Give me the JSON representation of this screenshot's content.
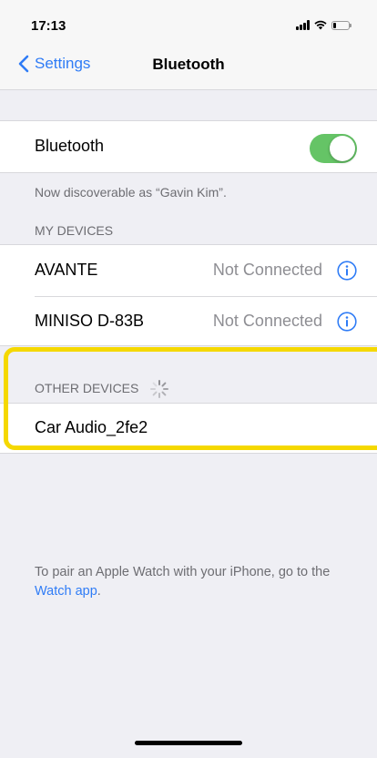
{
  "status_bar": {
    "time": "17:13",
    "battery_level": 0.2
  },
  "nav": {
    "back_label": "Settings",
    "title": "Bluetooth"
  },
  "bluetooth": {
    "label": "Bluetooth",
    "enabled": true,
    "discoverable_text": "Now discoverable as “Gavin Kim”."
  },
  "my_devices": {
    "header": "MY DEVICES",
    "items": [
      {
        "name": "AVANTE",
        "status": "Not Connected"
      },
      {
        "name": "MINISO D-83B",
        "status": "Not Connected"
      }
    ]
  },
  "other_devices": {
    "header": "OTHER DEVICES",
    "items": [
      {
        "name": "Car Audio_2fe2"
      }
    ]
  },
  "footer": {
    "text": "To pair an Apple Watch with your iPhone, go to the ",
    "link": "Watch app",
    "end": "."
  },
  "colors": {
    "accent": "#2f7cf6",
    "toggle_on": "#65c466",
    "highlight": "#f5d800"
  },
  "icons": {
    "back": "chevron-left-icon",
    "info": "info-circle-icon",
    "spinner": "activity-spinner-icon"
  }
}
